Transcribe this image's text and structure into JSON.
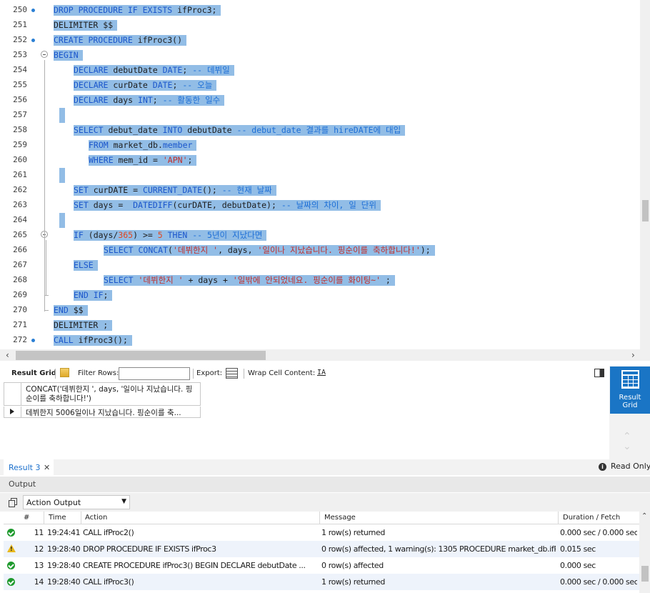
{
  "editor": {
    "lines": [
      {
        "n": "250",
        "dot": true,
        "indent": 0,
        "html": "<span class='kw'>DROP PROCEDURE IF EXISTS</span> ifProc3;"
      },
      {
        "n": "251",
        "dot": false,
        "indent": 0,
        "html": "DELIMITER $$"
      },
      {
        "n": "252",
        "dot": true,
        "indent": 0,
        "html": "<span class='kw'>CREATE PROCEDURE</span> ifProc3()"
      },
      {
        "n": "253",
        "dot": false,
        "indent": 0,
        "fold": true,
        "html": "<span class='kw'>BEGIN</span>"
      },
      {
        "n": "254",
        "dot": false,
        "indent": 4,
        "html": "<span class='kw'>DECLARE</span> debutDate <span class='kw'>DATE</span>; <span class='cm'>-- 데뷔일</span>"
      },
      {
        "n": "255",
        "dot": false,
        "indent": 4,
        "html": "<span class='kw'>DECLARE</span> curDate <span class='kw'>DATE</span>; <span class='cm'>-- 오늘</span>"
      },
      {
        "n": "256",
        "dot": false,
        "indent": 4,
        "html": "<span class='kw'>DECLARE</span> days <span class='kw'>INT</span>; <span class='cm'>-- 활동한 일수</span>"
      },
      {
        "n": "257",
        "dot": false,
        "indent": 0,
        "empty": true,
        "html": ""
      },
      {
        "n": "258",
        "dot": false,
        "indent": 4,
        "html": "<span class='kw'>SELECT</span> debut_date <span class='kw'>INTO</span> debutDate <span class='cm'>-- debut_date 결과를 hireDATE에 대입</span>"
      },
      {
        "n": "259",
        "dot": false,
        "indent": 7,
        "html": "<span class='kw'>FROM</span> market_db.<span class='kw'>member</span>"
      },
      {
        "n": "260",
        "dot": false,
        "indent": 7,
        "html": "<span class='kw'>WHERE</span> mem_id = <span class='st'>'APN'</span>;"
      },
      {
        "n": "261",
        "dot": false,
        "indent": 0,
        "empty": true,
        "html": ""
      },
      {
        "n": "262",
        "dot": false,
        "indent": 4,
        "html": "<span class='kw'>SET</span> curDATE = <span class='kw'>CURRENT_DATE</span>(); <span class='cm'>-- 현재 날짜</span>"
      },
      {
        "n": "263",
        "dot": false,
        "indent": 4,
        "html": "<span class='kw'>SET</span> days =  <span class='kw'>DATEDIFF</span>(curDATE, debutDate); <span class='cm'>-- 날짜의 차이, 일 단위</span>"
      },
      {
        "n": "264",
        "dot": false,
        "indent": 0,
        "empty": true,
        "html": ""
      },
      {
        "n": "265",
        "dot": false,
        "indent": 4,
        "fold": true,
        "html": "<span class='kw'>IF</span> (days/<span class='nm'>365</span>) &gt;= <span class='nm'>5</span> <span class='kw'>THEN</span> <span class='cm'>-- 5년이 지났다면</span>"
      },
      {
        "n": "266",
        "dot": false,
        "indent": 10,
        "html": "<span class='kw'>SELECT</span> <span class='kw'>CONCAT</span>(<span class='st'>'데뷔한지 '</span>, days, <span class='st'>'일이나 지났습니다. 핑순이를 축하합니다!'</span>);"
      },
      {
        "n": "267",
        "dot": false,
        "indent": 4,
        "html": "<span class='kw'>ELSE</span>"
      },
      {
        "n": "268",
        "dot": false,
        "indent": 10,
        "html": "<span class='kw'>SELECT</span> <span class='st'>'데뷔한지 '</span> + days + <span class='st'>'일밖에 안되었네요. 핑순이를 화이팅~'</span> ;"
      },
      {
        "n": "269",
        "dot": false,
        "indent": 4,
        "foldend": true,
        "html": "<span class='kw'>END IF</span>;"
      },
      {
        "n": "270",
        "dot": false,
        "indent": 0,
        "foldend": true,
        "html": "<span class='kw'>END</span> $$"
      },
      {
        "n": "271",
        "dot": false,
        "indent": 0,
        "html": "DELIMITER ;"
      },
      {
        "n": "272",
        "dot": true,
        "indent": 0,
        "html": "<span class='kw'>CALL</span> ifProc3();"
      }
    ]
  },
  "result_toolbar": {
    "result_grid_label": "Result Grid",
    "filter_rows_label": "Filter Rows:",
    "filter_value": "",
    "export_label": "Export:",
    "wrap_label": "Wrap Cell Content:"
  },
  "result_grid": {
    "column_header": "CONCAT('데뷔한지 ', days, '일이나 지났습니다. 핑순이를 축하합니다!')",
    "rows": [
      "데뷔한지 5006일이나 지났습니다. 핑순이를 축..."
    ]
  },
  "side_panel": {
    "button_label": "Result Grid"
  },
  "result_tabs": {
    "tab_label": "Result 3",
    "close": "✕",
    "read_only": "Read Only"
  },
  "output": {
    "header": "Output",
    "dropdown_value": "Action Output",
    "columns": [
      "#",
      "Time",
      "Action",
      "Message",
      "Duration / Fetch"
    ],
    "rows": [
      {
        "status": "ok",
        "num": "11",
        "time": "19:24:41",
        "action": "CALL ifProc2()",
        "message": "1 row(s) returned",
        "duration": "0.000 sec / 0.000 sec"
      },
      {
        "status": "warn",
        "num": "12",
        "time": "19:28:40",
        "action": "DROP PROCEDURE IF EXISTS ifProc3",
        "message": "0 row(s) affected, 1 warning(s): 1305 PROCEDURE market_db.ifPr...",
        "duration": "0.015 sec"
      },
      {
        "status": "ok",
        "num": "13",
        "time": "19:28:40",
        "action": "CREATE PROCEDURE ifProc3() BEGIN    DECLARE debutDate ...",
        "message": "0 row(s) affected",
        "duration": "0.000 sec"
      },
      {
        "status": "ok",
        "num": "14",
        "time": "19:28:40",
        "action": "CALL ifProc3()",
        "message": "1 row(s) returned",
        "duration": "0.000 sec / 0.000 sec"
      }
    ]
  }
}
